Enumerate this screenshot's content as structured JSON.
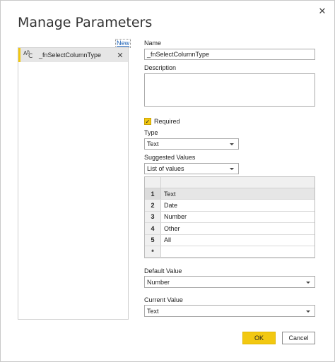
{
  "dialog": {
    "title": "Manage Parameters",
    "close_glyph": "✕"
  },
  "sidebar": {
    "new_label": "New",
    "items": [
      {
        "icon": "text-type-icon",
        "icon_a": "A",
        "icon_b": "B",
        "icon_c": "C",
        "label": "_fnSelectColumnType",
        "delete_glyph": "✕"
      }
    ],
    "accent_color": "#f2c811"
  },
  "form": {
    "name_label": "Name",
    "name_value": "_fnSelectColumnType",
    "description_label": "Description",
    "description_value": "",
    "required_checked": true,
    "required_label": "Required",
    "check_glyph": "✓",
    "type_label": "Type",
    "type_value": "Text",
    "suggested_label": "Suggested Values",
    "suggested_value": "List of values",
    "values_table": {
      "rows": [
        {
          "num": "1",
          "value": "Text"
        },
        {
          "num": "2",
          "value": "Date"
        },
        {
          "num": "3",
          "value": "Number"
        },
        {
          "num": "4",
          "value": "Other"
        },
        {
          "num": "5",
          "value": "All"
        },
        {
          "num": "*",
          "value": ""
        }
      ]
    },
    "default_label": "Default Value",
    "default_value": "Number",
    "current_label": "Current Value",
    "current_value": "Text"
  },
  "buttons": {
    "ok": "OK",
    "cancel": "Cancel"
  }
}
